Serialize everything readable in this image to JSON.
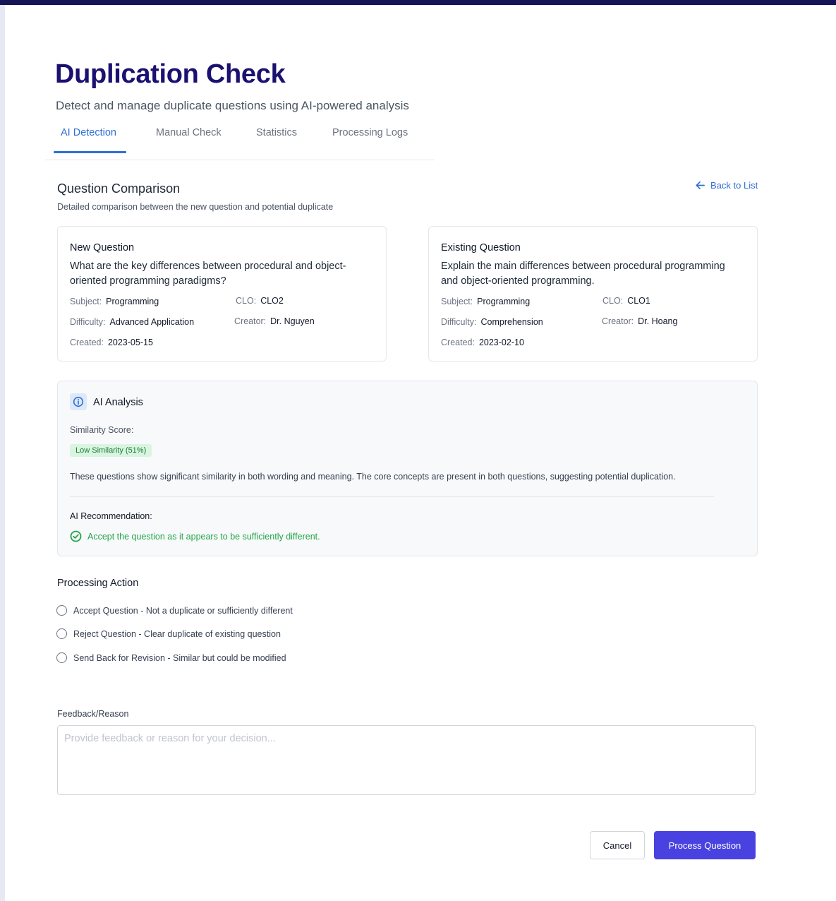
{
  "header": {
    "title": "Duplication Check",
    "subtitle": "Detect and manage duplicate questions using AI-powered analysis"
  },
  "tabs": [
    {
      "label": "AI Detection",
      "active": true
    },
    {
      "label": "Manual Check",
      "active": false
    },
    {
      "label": "Statistics",
      "active": false
    },
    {
      "label": "Processing Logs",
      "active": false
    }
  ],
  "comparison": {
    "title": "Question Comparison",
    "description": "Detailed comparison between the new question and potential duplicate",
    "back_label": "Back to List",
    "back_icon": "arrow-left-icon"
  },
  "new_question": {
    "heading": "New Question",
    "text": "What are the key differences between procedural and object-oriented programming paradigms?",
    "subject_label": "Subject:",
    "subject": "Programming",
    "clo_label": "CLO:",
    "clo": "CLO2",
    "difficulty_label": "Difficulty:",
    "difficulty": "Advanced Application",
    "creator_label": "Creator:",
    "creator": "Dr. Nguyen",
    "created_label": "Created:",
    "created": "2023-05-15"
  },
  "existing_question": {
    "heading": "Existing Question",
    "text": "Explain the main differences between procedural programming and object-oriented programming.",
    "subject_label": "Subject:",
    "subject": "Programming",
    "clo_label": "CLO:",
    "clo": "CLO1",
    "difficulty_label": "Difficulty:",
    "difficulty": "Comprehension",
    "creator_label": "Creator:",
    "creator": "Dr. Hoang",
    "created_label": "Created:",
    "created": "2023-02-10"
  },
  "ai_analysis": {
    "title": "AI Analysis",
    "icon": "info-icon",
    "similarity_label": "Similarity Score:",
    "similarity_badge": "Low Similarity (51%)",
    "similarity_percent": 51,
    "analysis_text": "These questions show significant similarity in both wording and meaning. The core concepts are present in both questions, suggesting potential duplication.",
    "recommendation_label": "AI Recommendation:",
    "recommendation_text": "Accept the question as it appears to be sufficiently different.",
    "recommendation_icon": "check-circle-icon"
  },
  "processing": {
    "title": "Processing Action",
    "options": [
      "Accept Question - Not a duplicate or sufficiently different",
      "Reject Question - Clear duplicate of existing question",
      "Send Back for Revision - Similar but could be modified"
    ]
  },
  "feedback": {
    "label": "Feedback/Reason",
    "value": "",
    "placeholder": "Provide feedback or reason for your decision..."
  },
  "actions": {
    "cancel_label": "Cancel",
    "process_label": "Process Question"
  },
  "colors": {
    "title": "#1a1170",
    "accent": "#2f6fd6",
    "primary_button": "#4a42e0",
    "success": "#22a447",
    "badge_bg": "#d9f5df",
    "top_bar": "#161456"
  }
}
